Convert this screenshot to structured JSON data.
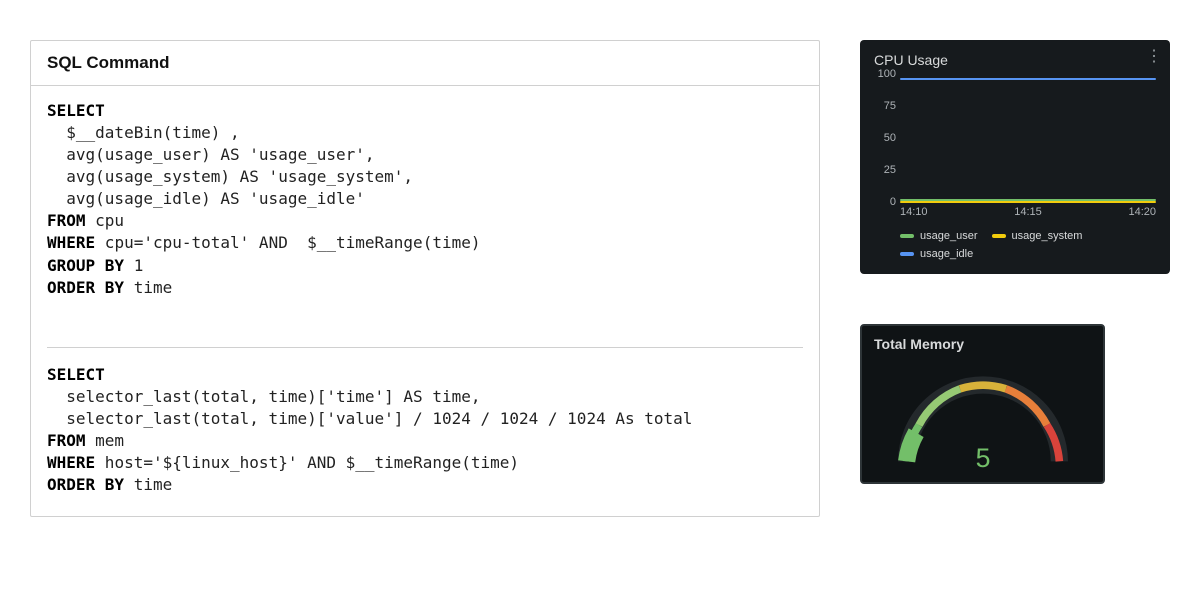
{
  "sql_panel": {
    "header": "SQL Command",
    "q1": {
      "l1a": "SELECT",
      "l2": "  $__dateBin(time) ,",
      "l3": "  avg(usage_user) AS 'usage_user',",
      "l4": "  avg(usage_system) AS 'usage_system',",
      "l5": "  avg(usage_idle) AS 'usage_idle'",
      "l6a": "FROM",
      "l6b": " cpu",
      "l7a": "WHERE",
      "l7b": " cpu='cpu-total' AND  $__timeRange(time)",
      "l8a": "GROUP BY",
      "l8b": " 1",
      "l9a": "ORDER BY",
      "l9b": " time"
    },
    "q2": {
      "l1a": "SELECT",
      "l2": "  selector_last(total, time)['time'] AS time,",
      "l3": "  selector_last(total, time)['value'] / 1024 / 1024 / 1024 As total",
      "l4a": "FROM",
      "l4b": " mem",
      "l5a": "WHERE",
      "l5b": " host='${linux_host}' AND $__timeRange(time)",
      "l6a": "ORDER BY",
      "l6b": " time"
    }
  },
  "cpu_panel": {
    "title": "CPU Usage",
    "menu_icon": "⋮",
    "yticks": [
      "100",
      "75",
      "50",
      "25",
      "0"
    ],
    "xticks": [
      "14:10",
      "14:15",
      "14:20"
    ],
    "legend": {
      "usage_user": {
        "label": "usage_user",
        "color": "#73bf69"
      },
      "usage_system": {
        "label": "usage_system",
        "color": "#f2cc0c"
      },
      "usage_idle": {
        "label": "usage_idle",
        "color": "#5794f2"
      }
    }
  },
  "gauge_panel": {
    "title": "Total Memory",
    "value": "5"
  },
  "chart_data": [
    {
      "type": "line",
      "title": "CPU Usage",
      "xlabel": "",
      "ylabel": "",
      "ylim": [
        0,
        100
      ],
      "x": [
        "14:10",
        "14:15",
        "14:20"
      ],
      "series": [
        {
          "name": "usage_user",
          "color": "#73bf69",
          "values": [
            2,
            2,
            2
          ]
        },
        {
          "name": "usage_system",
          "color": "#f2cc0c",
          "values": [
            1,
            1,
            1
          ]
        },
        {
          "name": "usage_idle",
          "color": "#5794f2",
          "values": [
            97,
            97,
            97
          ]
        }
      ]
    },
    {
      "type": "gauge",
      "title": "Total Memory",
      "value": 5,
      "min": 0,
      "max": 10,
      "color": "#73bf69"
    }
  ]
}
